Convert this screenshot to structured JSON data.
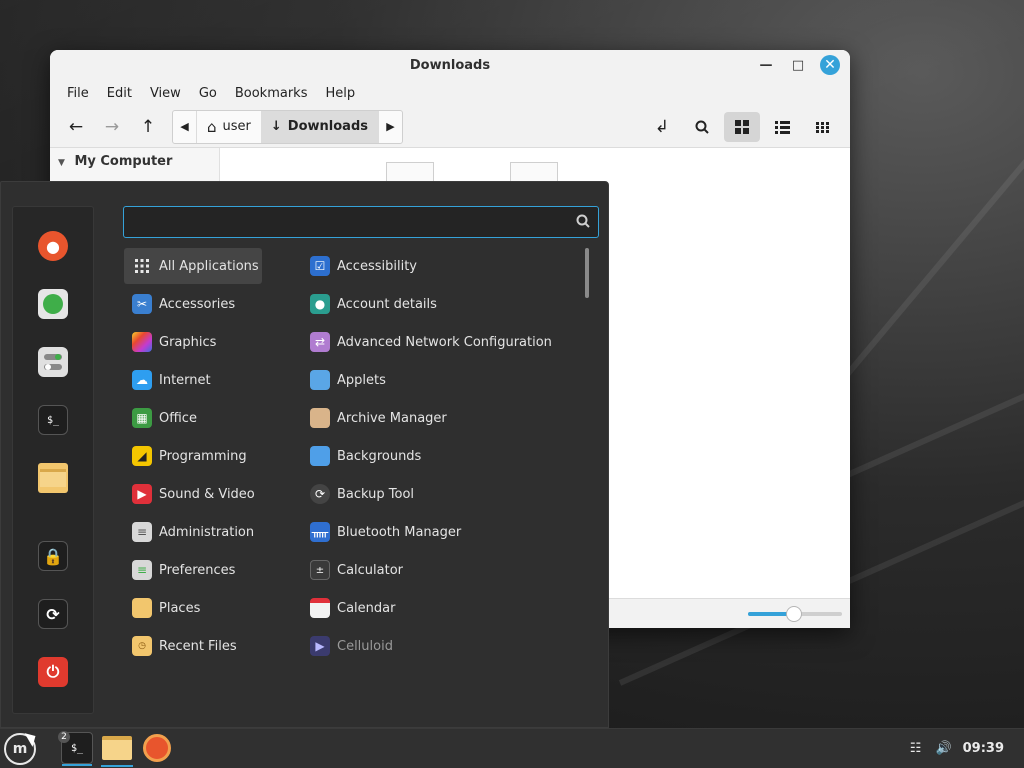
{
  "file_manager": {
    "title": "Downloads",
    "menus": [
      "File",
      "Edit",
      "View",
      "Go",
      "Bookmarks",
      "Help"
    ],
    "path": [
      "user",
      "Downloads"
    ],
    "sidebar_heading": "My Computer"
  },
  "menu": {
    "search": {
      "value": "",
      "placeholder": ""
    },
    "categories": [
      {
        "label": "All Applications",
        "icon": "grid-icon",
        "color": "#2f2f2f",
        "selected": true
      },
      {
        "label": "Accessories",
        "icon": "scissors-icon",
        "color": "#3a7fd0"
      },
      {
        "label": "Graphics",
        "icon": "graphics-icon",
        "color": "#d84aa7"
      },
      {
        "label": "Internet",
        "icon": "cloud-icon",
        "color": "#2e9ef0"
      },
      {
        "label": "Office",
        "icon": "office-icon",
        "color": "#3c9b43"
      },
      {
        "label": "Programming",
        "icon": "programming-icon",
        "color": "#f4c600"
      },
      {
        "label": "Sound & Video",
        "icon": "play-icon",
        "color": "#e0303a"
      },
      {
        "label": "Administration",
        "icon": "toggle-icon",
        "color": "#d8d8d8"
      },
      {
        "label": "Preferences",
        "icon": "toggle-icon",
        "color": "#d8d8d8"
      },
      {
        "label": "Places",
        "icon": "folder-icon",
        "color": "#f2c66d"
      },
      {
        "label": "Recent Files",
        "icon": "recent-folder-icon",
        "color": "#f2c66d"
      }
    ],
    "apps": [
      {
        "label": "Accessibility",
        "icon": "accessibility-icon",
        "color": "#2d6fcf"
      },
      {
        "label": "Account details",
        "icon": "account-icon",
        "color": "#2a9d8f"
      },
      {
        "label": "Advanced Network Configuration",
        "icon": "network-icon",
        "color": "#b07cd0"
      },
      {
        "label": "Applets",
        "icon": "applets-icon",
        "color": "#5aa6e6"
      },
      {
        "label": "Archive Manager",
        "icon": "archive-icon",
        "color": "#d9b48a"
      },
      {
        "label": "Backgrounds",
        "icon": "backgrounds-icon",
        "color": "#4f9fe8"
      },
      {
        "label": "Backup Tool",
        "icon": "backup-icon",
        "color": "#444444"
      },
      {
        "label": "Bluetooth Manager",
        "icon": "bluetooth-icon",
        "color": "#2f6fd1"
      },
      {
        "label": "Calculator",
        "icon": "calculator-icon",
        "color": "#3a3a3a"
      },
      {
        "label": "Calendar",
        "icon": "calendar-icon",
        "color": "#f2f2f2"
      },
      {
        "label": "Celluloid",
        "icon": "celluloid-icon",
        "color": "#3b3b6e",
        "dim": true
      }
    ]
  },
  "favorites": [
    {
      "name": "firefox",
      "icon": "firefox-icon",
      "color": "#e8552d"
    },
    {
      "name": "software-manager",
      "icon": "software-manager-icon",
      "color": "#3fae49"
    },
    {
      "name": "settings",
      "icon": "settings-toggle-icon",
      "color": "#e0e0e0"
    },
    {
      "name": "terminal",
      "icon": "terminal-icon",
      "color": "#1e1e1e"
    },
    {
      "name": "files",
      "icon": "folder-icon",
      "color": "#f2c66d"
    },
    {
      "name": "lock-screen",
      "icon": "lock-icon",
      "color": "#1e1e1e"
    },
    {
      "name": "logout",
      "icon": "logout-icon",
      "color": "#1e1e1e"
    },
    {
      "name": "shutdown",
      "icon": "power-icon",
      "color": "#e03a2e"
    }
  ],
  "taskbar": {
    "terminal_badge": "2",
    "clock": "09:39",
    "accent": "#35a2d9"
  }
}
